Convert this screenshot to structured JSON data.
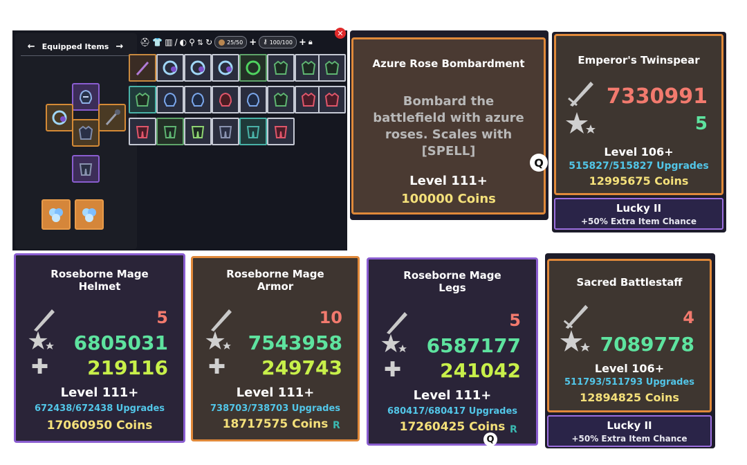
{
  "inventory": {
    "title": "Equipped Items",
    "storage_count": "25/50",
    "capacity_count": "100/100"
  },
  "skill_card": {
    "title": "Azure Rose Bombardment",
    "description": "Bombard the battlefield with azure roses. Scales with [SPELL]",
    "level": "Level 111+",
    "coins": "100000 Coins",
    "hotkey": "Q"
  },
  "twinspear": {
    "title": "Emperor's Twinspear",
    "damage": "7330991",
    "crit": "5",
    "level": "Level 106+",
    "upgrades": "515827/515827 Upgrades",
    "coins": "12995675 Coins",
    "enchant_name": "Lucky II",
    "enchant_desc": "+50% Extra Item Chance"
  },
  "helmet": {
    "title": "Roseborne Mage Helmet",
    "stat_top": "5",
    "stat_mid": "6805031",
    "stat_bot": "219116",
    "level": "Level 111+",
    "upgrades": "672438/672438 Upgrades",
    "coins": "17060950 Coins"
  },
  "armor": {
    "title": "Roseborne Mage Armor",
    "stat_top": "10",
    "stat_mid": "7543958",
    "stat_bot": "249743",
    "level": "Level 111+",
    "upgrades": "738703/738703 Upgrades",
    "coins": "18717575 Coins",
    "hotkey": "R"
  },
  "legs": {
    "title": "Roseborne Mage Legs",
    "stat_top": "5",
    "stat_mid": "6587177",
    "stat_bot": "241042",
    "level": "Level 111+",
    "upgrades": "680417/680417 Upgrades",
    "coins": "17260425 Coins",
    "hotkey_r": "R",
    "hotkey_q": "Q"
  },
  "battlestaff": {
    "title": "Sacred Battlestaff",
    "crit": "4",
    "damage": "7089778",
    "level": "Level 106+",
    "upgrades": "511793/511793 Upgrades",
    "coins": "12894825 Coins",
    "enchant_name": "Lucky II",
    "enchant_desc": "+50% Extra Item Chance"
  },
  "colors": {
    "orange_border": "#d58a36",
    "purple_border": "#8a5dd0",
    "damage_red": "#f27a6e",
    "stat_green": "#5ee39f",
    "stat_lime": "#c8f04a",
    "upgrades_blue": "#52c6e8",
    "coins_gold": "#f4e07a"
  }
}
